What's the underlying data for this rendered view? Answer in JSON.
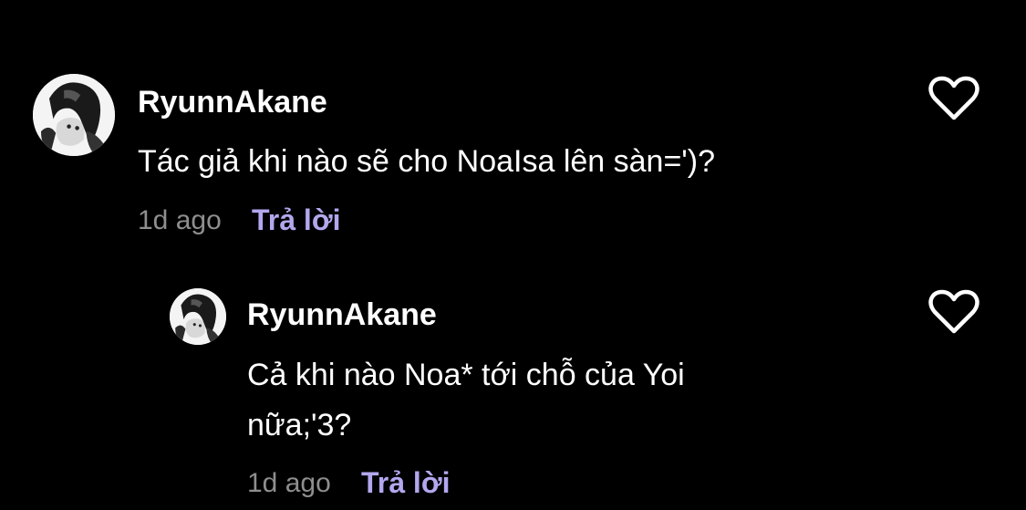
{
  "comment": {
    "username": "RyunnAkane",
    "text": "Tác giả khi nào sẽ cho NoaIsa lên sàn=')?",
    "time": "1d ago",
    "reply_label": "Trả lời",
    "avatar_icon": "user-avatar",
    "like_icon": "heart-outline-icon"
  },
  "reply": {
    "username": "RyunnAkane",
    "text_line1": "Cả khi nào Noa* tới chỗ của Yoi",
    "text_line2": "nữa;'3?",
    "time": "1d ago",
    "reply_label": "Trả lời",
    "avatar_icon": "user-avatar",
    "like_icon": "heart-outline-icon"
  },
  "colors": {
    "background": "#000000",
    "text": "#ffffff",
    "muted": "#8e8e8e",
    "accent": "#b3a7ee"
  }
}
